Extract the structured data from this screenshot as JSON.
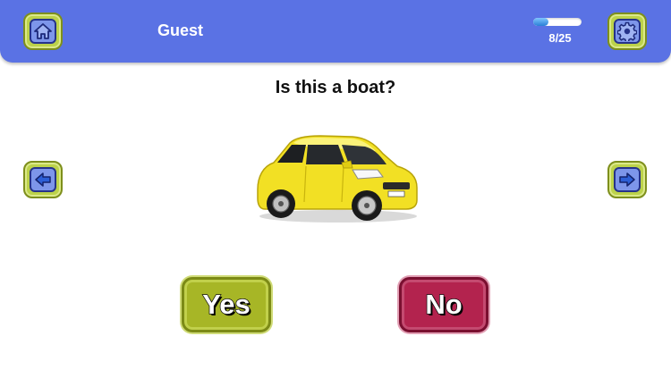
{
  "header": {
    "user_name": "Guest",
    "progress": {
      "current": 8,
      "total": 25,
      "label": "8/25"
    }
  },
  "icons": {
    "home": "home-icon",
    "settings": "gear-icon",
    "prev": "arrow-left-icon",
    "next": "arrow-right-icon"
  },
  "question": {
    "text": "Is this a boat?"
  },
  "image": {
    "subject": "yellow car"
  },
  "answers": {
    "yes_label": "Yes",
    "no_label": "No"
  },
  "colors": {
    "header_bg": "#5a72e4",
    "button_green": "#a7b626",
    "button_red": "#b3234e",
    "icon_blue": "#7d96ea"
  }
}
